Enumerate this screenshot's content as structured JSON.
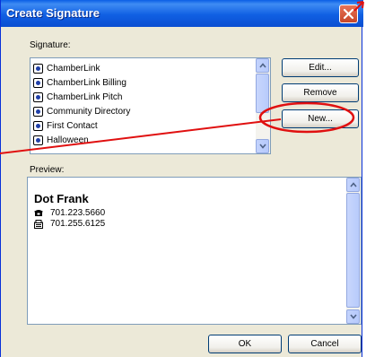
{
  "window": {
    "title": "Create Signature",
    "close_icon": "close-x-icon"
  },
  "signature_section": {
    "label": "Signature:",
    "items": [
      {
        "label": "ChamberLink"
      },
      {
        "label": "ChamberLink Billing"
      },
      {
        "label": "ChamberLink Pitch"
      },
      {
        "label": "Community Directory"
      },
      {
        "label": "First Contact"
      },
      {
        "label": "Halloween"
      }
    ]
  },
  "buttons": {
    "edit": "Edit...",
    "remove": "Remove",
    "new": "New...",
    "ok": "OK",
    "cancel": "Cancel"
  },
  "preview": {
    "label": "Preview:",
    "name": "Dot Frank",
    "phone": "701.223.5660",
    "fax": "701.255.6125"
  },
  "colors": {
    "title_bar": "#0a5ee6",
    "dialog_bg": "#ece9d8",
    "annotation": "#e01010"
  }
}
